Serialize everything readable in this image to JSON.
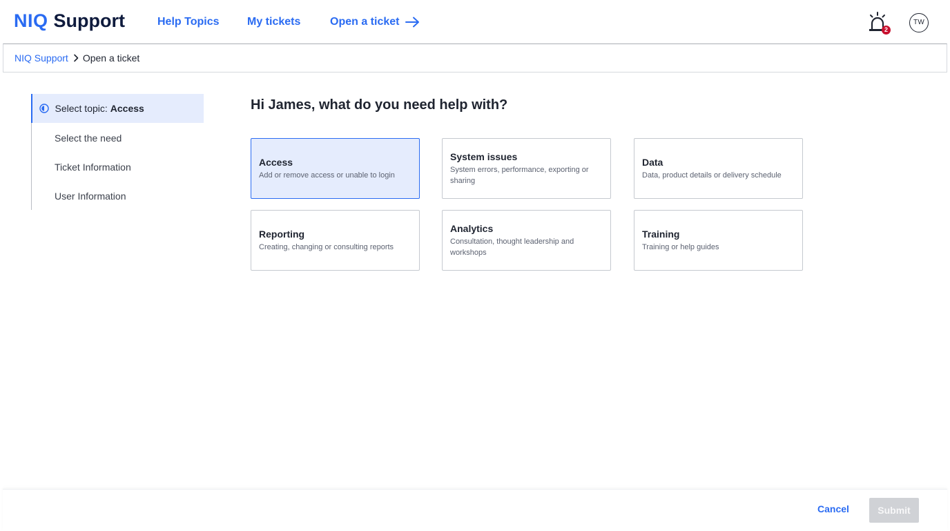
{
  "header": {
    "logo_text": "NIQ",
    "app_name": "Support",
    "nav": {
      "help_topics": "Help Topics",
      "my_tickets": "My tickets",
      "open_ticket": "Open a ticket"
    },
    "notifications_count": "2",
    "avatar_initials": "TW"
  },
  "breadcrumb": {
    "root": "NIQ Support",
    "current": "Open a ticket"
  },
  "steps": [
    {
      "label": "Select topic:",
      "value": "Access",
      "active": true
    },
    {
      "label": "Select the need",
      "active": false
    },
    {
      "label": "Ticket Information",
      "active": false
    },
    {
      "label": "User Information",
      "active": false
    }
  ],
  "main": {
    "greeting": "Hi James, what do you need help with?",
    "cards": [
      {
        "title": "Access",
        "description": "Add or remove access or unable to login",
        "selected": true
      },
      {
        "title": "System issues",
        "description": "System errors, performance, exporting or sharing",
        "selected": false
      },
      {
        "title": "Data",
        "description": "Data, product details or delivery schedule",
        "selected": false
      },
      {
        "title": "Reporting",
        "description": "Creating, changing or consulting reports",
        "selected": false
      },
      {
        "title": "Analytics",
        "description": "Consultation, thought leadership and workshops",
        "selected": false
      },
      {
        "title": "Training",
        "description": "Training or help guides",
        "selected": false
      }
    ]
  },
  "footer": {
    "cancel_label": "Cancel",
    "submit_label": "Submit"
  },
  "colors": {
    "accent": "#2a6bf2",
    "selected_bg": "#e5ecfd",
    "badge": "#c8102e",
    "disabled_button": "#d0d2d6"
  }
}
